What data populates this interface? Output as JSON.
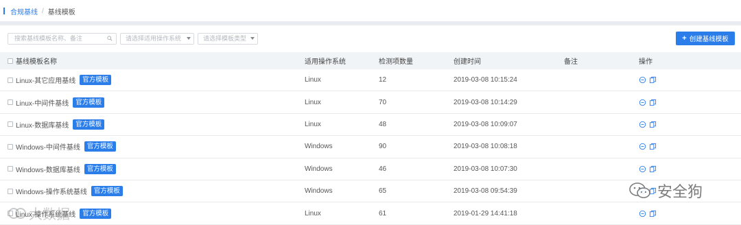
{
  "breadcrumb": {
    "parent": "合规基线",
    "separator": "/",
    "current": "基线模板"
  },
  "toolbar": {
    "search_placeholder": "搜索基线模板名称、备注",
    "os_select_placeholder": "请选择适用操作系统",
    "type_select_placeholder": "请选择模板类型",
    "create_label": "创建基线模板",
    "create_icon": "+"
  },
  "table": {
    "headers": {
      "name": "基线模板名称",
      "os": "适用操作系统",
      "count": "检测项数量",
      "time": "创建时间",
      "note": "备注",
      "op": "操作"
    },
    "rows": [
      {
        "name": "Linux-其它应用基线",
        "badge": "官方模板",
        "os": "Linux",
        "count": "12",
        "time": "2019-03-08 10:15:24",
        "note": ""
      },
      {
        "name": "Linux-中间件基线",
        "badge": "官方模板",
        "os": "Linux",
        "count": "70",
        "time": "2019-03-08 10:14:29",
        "note": ""
      },
      {
        "name": "Linux-数据库基线",
        "badge": "官方模板",
        "os": "Linux",
        "count": "48",
        "time": "2019-03-08 10:09:07",
        "note": ""
      },
      {
        "name": "Windows-中间件基线",
        "badge": "官方模板",
        "os": "Windows",
        "count": "90",
        "time": "2019-03-08 10:08:18",
        "note": ""
      },
      {
        "name": "Windows-数据库基线",
        "badge": "官方模板",
        "os": "Windows",
        "count": "46",
        "time": "2019-03-08 10:07:30",
        "note": ""
      },
      {
        "name": "Windows-操作系统基线",
        "badge": "官方模板",
        "os": "Windows",
        "count": "65",
        "time": "2019-03-08 09:54:39",
        "note": ""
      },
      {
        "name": "Linux-操作系统基线",
        "badge": "官方模板",
        "os": "Linux",
        "count": "61",
        "time": "2019-01-29 14:41:18",
        "note": ""
      }
    ]
  },
  "watermarks": {
    "wechat_account": "安全狗",
    "bottom_left": "大数据"
  },
  "colors": {
    "accent": "#2b7de9",
    "header_bg": "#f1f4f7",
    "band": "#e9edf2"
  },
  "icons": {
    "row_actions": [
      "view-icon",
      "copy-icon"
    ],
    "search": "search-icon",
    "wechat": "wechat-icon"
  }
}
